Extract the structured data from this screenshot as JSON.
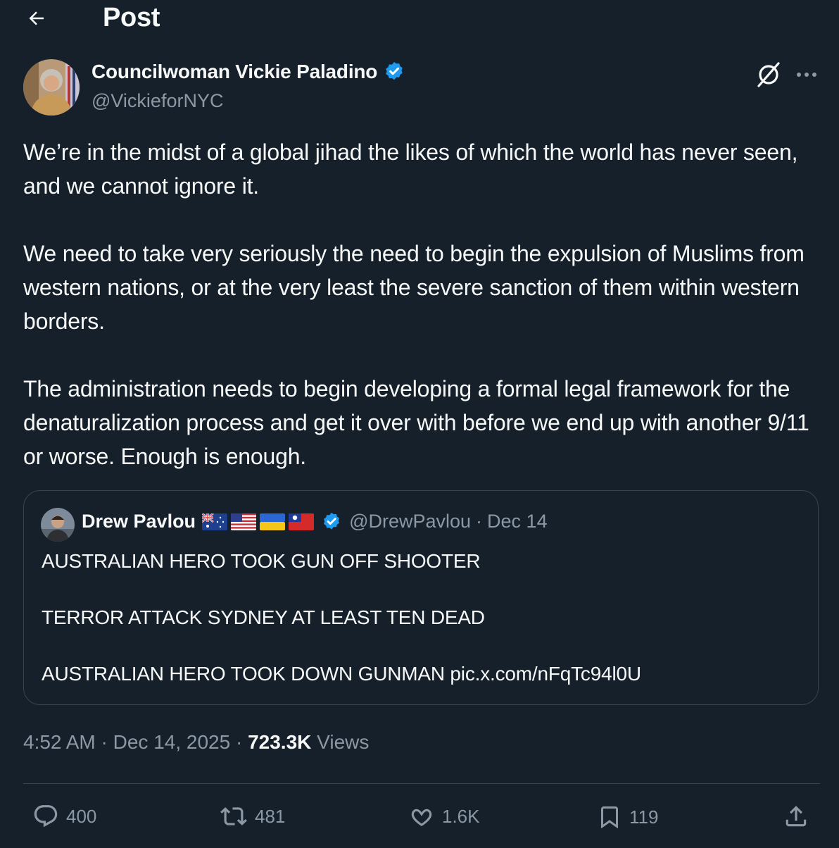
{
  "header": {
    "title": "Post",
    "back_icon": "arrow-left-icon"
  },
  "author": {
    "name": "Councilwoman Vickie Paladino",
    "handle": "@VickieforNYC",
    "verified": true
  },
  "post": {
    "paragraphs": [
      "We’re in the midst of a global jihad the likes of which the world has never seen, and we cannot ignore it.",
      "We need to take very seriously the need to begin the expulsion of Muslims from western nations, or at the very least the severe sanction of them within western borders.",
      "The administration needs to begin developing a formal legal framework for the denaturalization process and get it over with before we end up with another 9/11 or worse. Enough is enough."
    ]
  },
  "quote": {
    "name": "Drew Pavlou",
    "flags": [
      "australia-flag-icon",
      "usa-flag-icon",
      "ukraine-flag-icon",
      "taiwan-flag-icon"
    ],
    "verified": true,
    "handle": "@DrewPavlou",
    "date": "Dec 14",
    "paragraphs": [
      "AUSTRALIAN HERO TOOK GUN OFF SHOOTER",
      "TERROR ATTACK SYDNEY AT LEAST TEN DEAD",
      "AUSTRALIAN HERO TOOK DOWN GUNMAN pic.x.com/nFqTc94l0U"
    ]
  },
  "meta": {
    "time": "4:52 AM",
    "date": "Dec 14, 2025",
    "views_count": "723.3K",
    "views_label": "Views"
  },
  "actions": {
    "replies": "400",
    "reposts": "481",
    "likes": "1.6K",
    "bookmarks": "119"
  },
  "colors": {
    "background": "#15202b",
    "text": "#f7f9f9",
    "secondary_text": "#8b98a5",
    "border": "#38444d",
    "verified_badge": "#1d9bf0"
  }
}
